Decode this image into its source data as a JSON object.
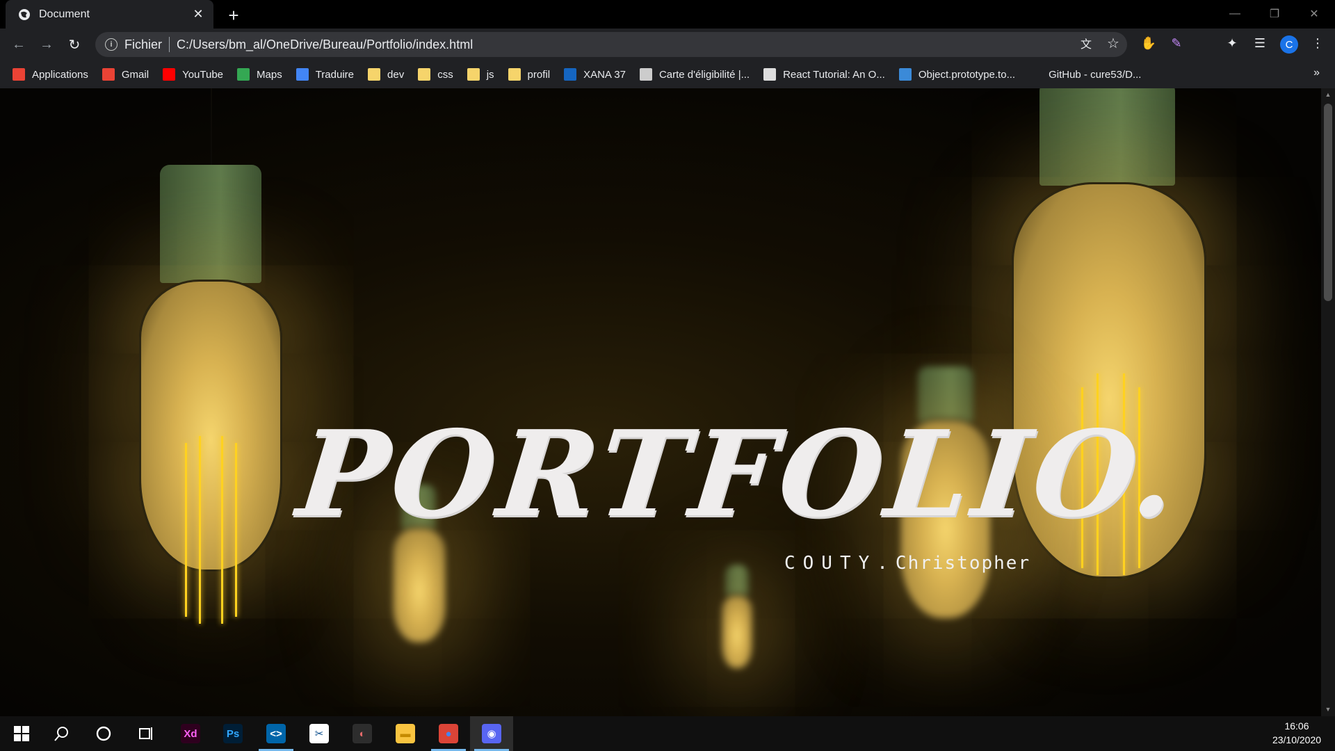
{
  "browser": {
    "tab_title": "Document",
    "scheme_label": "Fichier",
    "url": "C:/Users/bm_al/OneDrive/Bureau/Portfolio/index.html",
    "profile_initial": "C"
  },
  "bookmarks": [
    {
      "label": "Applications",
      "icon": "apps-grid-icon",
      "color": "#ea4335"
    },
    {
      "label": "Gmail",
      "icon": "gmail-icon",
      "color": "#ea4335"
    },
    {
      "label": "YouTube",
      "icon": "youtube-icon",
      "color": "#ff0000"
    },
    {
      "label": "Maps",
      "icon": "maps-icon",
      "color": "#34a853"
    },
    {
      "label": "Traduire",
      "icon": "translate-icon",
      "color": "#4285f4"
    },
    {
      "label": "dev",
      "icon": "folder-icon",
      "color": "#f6d46b"
    },
    {
      "label": "css",
      "icon": "folder-icon",
      "color": "#f6d46b"
    },
    {
      "label": "js",
      "icon": "folder-icon",
      "color": "#f6d46b"
    },
    {
      "label": "profil",
      "icon": "folder-icon",
      "color": "#f6d46b"
    },
    {
      "label": "XANA 37",
      "icon": "dsm-icon",
      "color": "#1565c0"
    },
    {
      "label": "Carte d'éligibilité |...",
      "icon": "site-icon",
      "color": "#cccccc"
    },
    {
      "label": "React Tutorial: An O...",
      "icon": "floppy-icon",
      "color": "#dddddd"
    },
    {
      "label": "Object.prototype.to...",
      "icon": "mdn-icon",
      "color": "#3b8ad8"
    },
    {
      "label": "GitHub - cure53/D...",
      "icon": "github-icon",
      "color": "#202124"
    }
  ],
  "hero": {
    "title": "PORTFOLIO.",
    "subtitle_name": "COUTY.",
    "subtitle_first": "Christopher"
  },
  "taskbar": {
    "time": "16:06",
    "date": "23/10/2020",
    "apps": [
      {
        "name": "xd-icon",
        "label": "Xd",
        "bg": "#2e001e",
        "fg": "#ff61f6"
      },
      {
        "name": "photoshop-icon",
        "label": "Ps",
        "bg": "#001e36",
        "fg": "#31a8ff"
      },
      {
        "name": "vscode-icon",
        "label": "<>",
        "bg": "#0065a9",
        "fg": "#ffffff"
      },
      {
        "name": "snipping-icon",
        "label": "✂",
        "bg": "#ffffff",
        "fg": "#0a4d8c"
      },
      {
        "name": "paint-icon",
        "label": "◐",
        "bg": "#2d2d2d",
        "fg": "#e46a6a"
      },
      {
        "name": "file-explorer-icon",
        "label": "▬",
        "bg": "#f9c440",
        "fg": "#c58a00"
      },
      {
        "name": "chrome-icon",
        "label": "●",
        "bg": "#db4437",
        "fg": "#4285f4"
      },
      {
        "name": "discord-icon",
        "label": "◉",
        "bg": "#5865f2",
        "fg": "#ffffff"
      }
    ]
  }
}
